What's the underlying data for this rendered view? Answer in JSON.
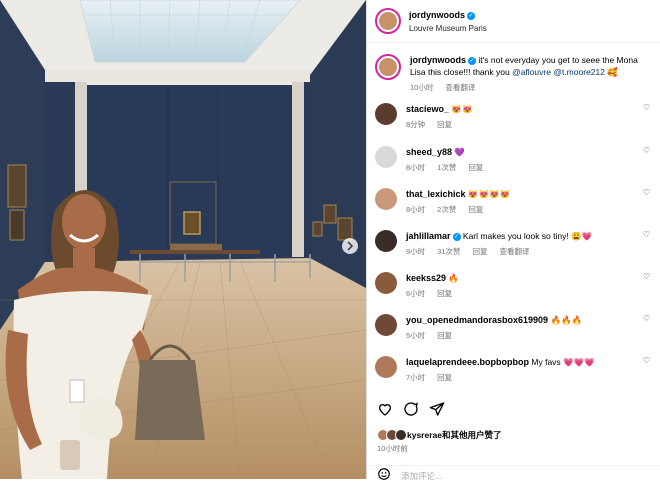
{
  "post": {
    "username": "jordynwoods",
    "location": "Louvre Museum Paris",
    "caption_user": "jordynwoods",
    "caption_text": "it's not everyday you get to seee the Mona Lisa this close!!! thank you ",
    "mention1": "@aflouvre",
    "mention2": "@t.moore212",
    "caption_emoji": "🥰",
    "caption_time": "10小时",
    "translate": "查看翻译"
  },
  "comments": [
    {
      "user": "staciewo_",
      "text": "😻😻",
      "time": "8分钟",
      "likes": "",
      "reply": "回复",
      "translate": "",
      "verified": false,
      "avatar_color": "#5a3b2e"
    },
    {
      "user": "sheed_y88",
      "text": "💜",
      "time": "8小时",
      "likes": "1次赞",
      "reply": "回复",
      "translate": "",
      "verified": false,
      "avatar_color": "#d9d9d9"
    },
    {
      "user": "that_lexichick",
      "text": "😻😻😻😻",
      "time": "8小时",
      "likes": "2次赞",
      "reply": "回复",
      "translate": "",
      "verified": false,
      "avatar_color": "#c99a7a"
    },
    {
      "user": "jahlillamar",
      "text": "Karl makes you look so tiny! 😩💗",
      "time": "9小时",
      "likes": "31次赞",
      "reply": "回复",
      "translate": "查看翻译",
      "verified": true,
      "avatar_color": "#3a2c28"
    },
    {
      "user": "keekss29",
      "text": "🔥",
      "time": "6小时",
      "likes": "",
      "reply": "回复",
      "translate": "",
      "verified": false,
      "avatar_color": "#8a5a3c"
    },
    {
      "user": "you_openedmandorasbox619909",
      "text": "🔥🔥🔥",
      "time": "5小时",
      "likes": "",
      "reply": "回复",
      "translate": "",
      "verified": false,
      "avatar_color": "#6e4a36"
    },
    {
      "user": "laquelaprendeee.bopbopbop",
      "text": "My favs 💗💗💗",
      "time": "7小时",
      "likes": "",
      "reply": "回复",
      "translate": "",
      "verified": false,
      "avatar_color": "#b07a5a"
    }
  ],
  "footer": {
    "liked_by_user": "kysrerae",
    "liked_by_suffix": "和其他用户赞了",
    "time": "10小时前",
    "add_comment_placeholder": "添加评论..."
  },
  "icons": [
    "verified-icon",
    "heart-icon",
    "comment-icon",
    "share-icon",
    "emoji-icon"
  ],
  "colors": {
    "link": "#00376b",
    "verified": "#0095f6",
    "ring": "#d6249f",
    "meta": "#737373"
  }
}
